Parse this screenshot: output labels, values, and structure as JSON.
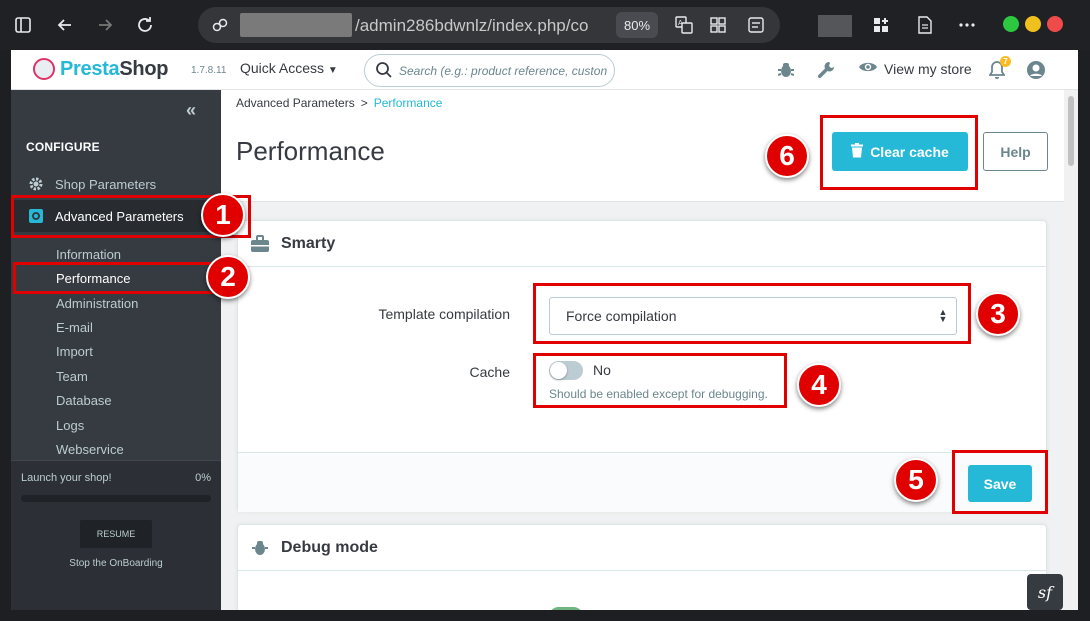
{
  "browser": {
    "url": "/admin286bdwnlz/index.php/co",
    "zoom": "80%"
  },
  "header": {
    "logo_part1": "Presta",
    "logo_part2": "Shop",
    "version": "1.7.8.11",
    "quick_access": "Quick Access",
    "search_placeholder": "Search (e.g.: product reference, custon",
    "view_store": "View my store",
    "notifications_count": "7"
  },
  "sidebar": {
    "section": "CONFIGURE",
    "items": [
      {
        "label": "Shop Parameters"
      },
      {
        "label": "Advanced Parameters"
      }
    ],
    "subitems": [
      {
        "label": "Information"
      },
      {
        "label": "Performance"
      },
      {
        "label": "Administration"
      },
      {
        "label": "E-mail"
      },
      {
        "label": "Import"
      },
      {
        "label": "Team"
      },
      {
        "label": "Database"
      },
      {
        "label": "Logs"
      },
      {
        "label": "Webservice"
      }
    ],
    "onboarding": {
      "label": "Launch your shop!",
      "percent": "0%",
      "resume": "RESUME",
      "stop": "Stop the OnBoarding"
    }
  },
  "main": {
    "breadcrumb": {
      "parent": "Advanced Parameters",
      "separator": ">",
      "current": "Performance"
    },
    "title": "Performance",
    "clear_cache": "Clear cache",
    "help": "Help",
    "smarty": {
      "title": "Smarty",
      "template_label": "Template compilation",
      "template_value": "Force compilation",
      "cache_label": "Cache",
      "cache_value": "No",
      "cache_help": "Should be enabled except for debugging.",
      "save": "Save"
    },
    "debug": {
      "title": "Debug mode"
    }
  },
  "annotations": [
    "1",
    "2",
    "3",
    "4",
    "5",
    "6"
  ],
  "colors": {
    "accent": "#25b9d7",
    "sidebar": "#363a41",
    "annotation": "#e00000"
  }
}
